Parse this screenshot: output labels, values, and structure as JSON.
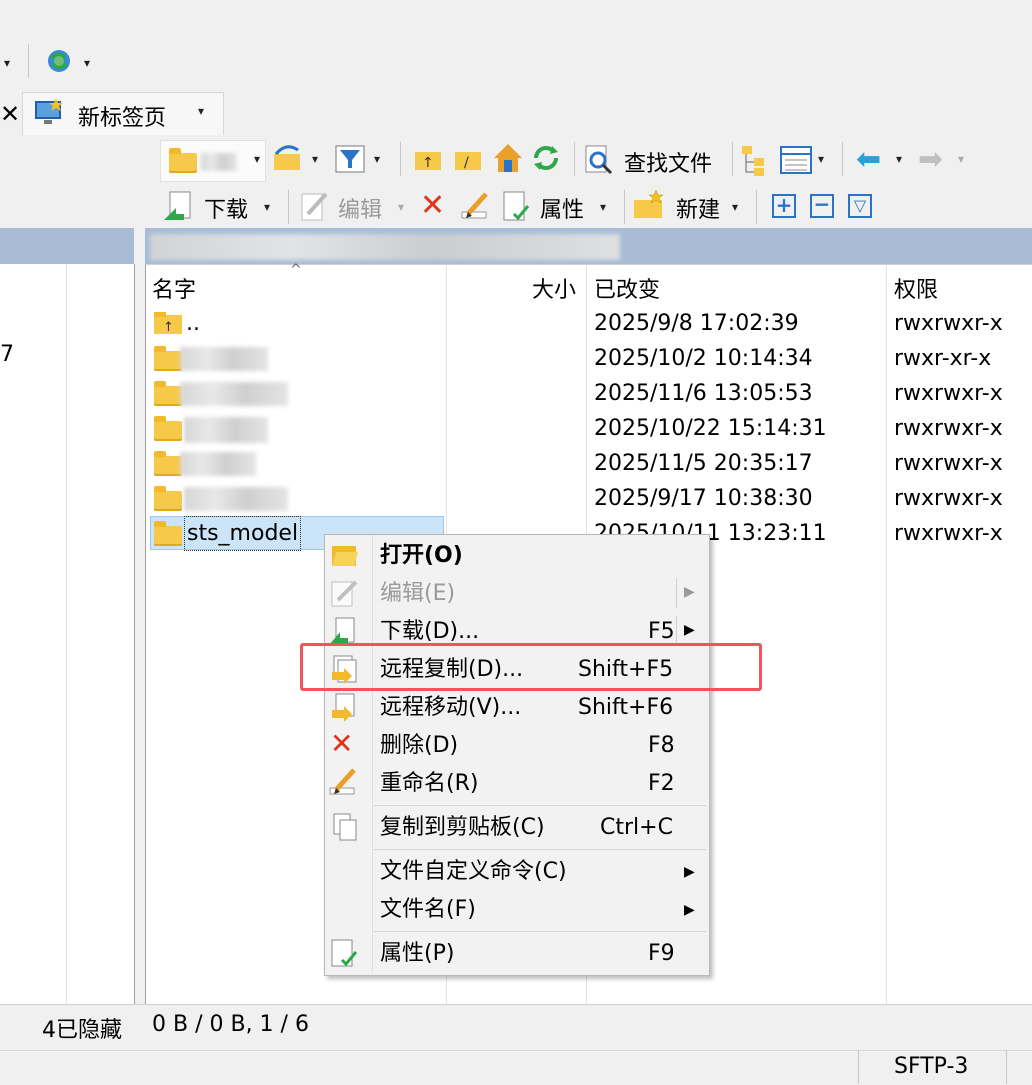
{
  "toolbar_top": {
    "sync_icon": "sync-globe-icon"
  },
  "tab": {
    "label": "新标签页",
    "close_icon": "close-icon"
  },
  "remote_toolbar": {
    "find_files": "查找文件",
    "download": "下载",
    "edit": "编辑",
    "properties": "属性",
    "new": "新建"
  },
  "file_list": {
    "columns": [
      "名字",
      "大小",
      "已改变",
      "权限"
    ],
    "rows": [
      {
        "name": "..",
        "changed": "2025/9/8 17:02:39",
        "perm": "rwxrwxr-x",
        "icon": "parent-folder-icon"
      },
      {
        "name": "",
        "changed": "2025/10/2 10:14:34",
        "perm": "rwxr-xr-x",
        "icon": "folder-icon"
      },
      {
        "name": "",
        "changed": "2025/11/6 13:05:53",
        "perm": "rwxrwxr-x",
        "icon": "folder-icon"
      },
      {
        "name": "",
        "changed": "2025/10/22 15:14:31",
        "perm": "rwxrwxr-x",
        "icon": "folder-icon"
      },
      {
        "name": "",
        "changed": "2025/11/5 20:35:17",
        "perm": "rwxrwxr-x",
        "icon": "folder-icon"
      },
      {
        "name": "",
        "changed": "2025/9/17 10:38:30",
        "perm": "rwxrwxr-x",
        "icon": "folder-icon"
      },
      {
        "name": "sts_model",
        "changed": "2025/10/11 13:23:11",
        "perm": "rwxrwxr-x",
        "icon": "folder-icon"
      }
    ]
  },
  "left_panel": {
    "fragment": "7"
  },
  "context_menu": {
    "items": [
      {
        "label": "打开(O)",
        "shortcut": ""
      },
      {
        "label": "编辑(E)",
        "shortcut": ""
      },
      {
        "label": "下载(D)...",
        "shortcut": "F5"
      },
      {
        "label": "远程复制(D)...",
        "shortcut": "Shift+F5"
      },
      {
        "label": "远程移动(V)...",
        "shortcut": "Shift+F6"
      },
      {
        "label": "删除(D)",
        "shortcut": "F8"
      },
      {
        "label": "重命名(R)",
        "shortcut": "F2"
      },
      {
        "label": "复制到剪贴板(C)",
        "shortcut": "Ctrl+C"
      },
      {
        "label": "文件自定义命令(C)",
        "shortcut": ""
      },
      {
        "label": "文件名(F)",
        "shortcut": ""
      },
      {
        "label": "属性(P)",
        "shortcut": "F9"
      }
    ]
  },
  "status": {
    "hidden": "4已隐藏",
    "sizes": "0 B / 0 B,  1 / 6",
    "protocol": "SFTP-3"
  },
  "colors": {
    "highlight_border": "#f0555c",
    "path_bar": "#a8bcd6",
    "selection": "#cce4f7"
  }
}
